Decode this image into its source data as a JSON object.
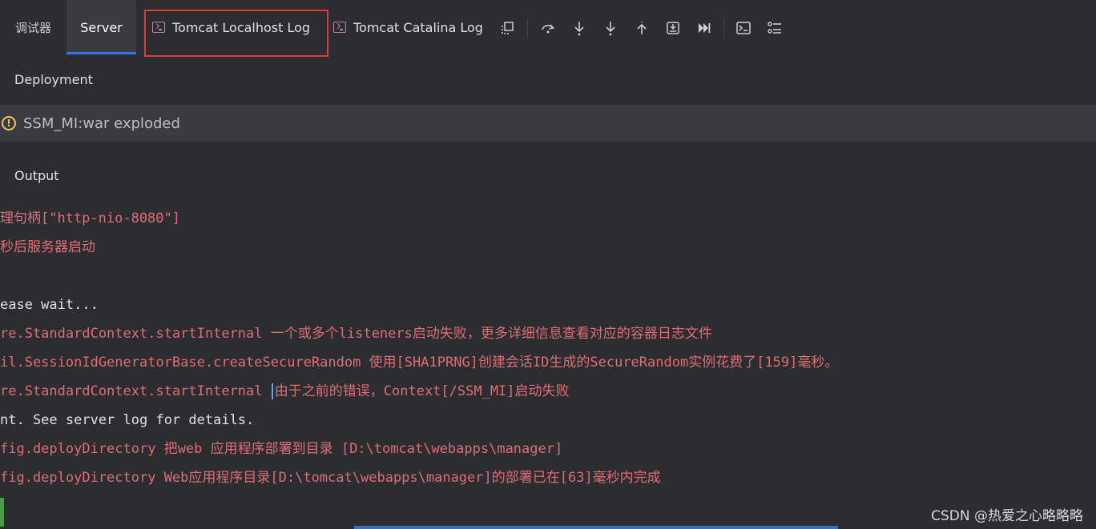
{
  "tabs": {
    "debugger": "调试器",
    "server": "Server",
    "localhost_log": "Tomcat Localhost Log",
    "catalina_log": "Tomcat Catalina Log"
  },
  "toolbar_icons": [
    "restore-layout-icon",
    "step-over-icon",
    "step-into-icon",
    "force-step-into-icon",
    "step-out-icon",
    "run-to-cursor-icon",
    "resume-icon",
    "evaluate-expression-icon",
    "more-options-icon"
  ],
  "deployment": {
    "label": "Deployment",
    "artifact": "SSM_MI:war exploded"
  },
  "output": {
    "label": "Output",
    "lines": [
      {
        "text": "理句柄[\"http-nio-8080\"]",
        "style": "red"
      },
      {
        "text": "秒后服务器启动",
        "style": "red"
      },
      {
        "text": "",
        "style": "white"
      },
      {
        "text": "ease wait...",
        "style": "white"
      },
      {
        "text": "re.StandardContext.startInternal 一个或多个listeners启动失败，更多详细信息查看对应的容器日志文件",
        "style": "red"
      },
      {
        "text": "il.SessionIdGeneratorBase.createSecureRandom 使用[SHA1PRNG]创建会话ID生成的SecureRandom实例花费了[159]毫秒。",
        "style": "red"
      },
      {
        "text_before_caret": "re.StandardContext.startInternal ",
        "text_after_caret": "由于之前的错误，Context[/SSM_MI]启动失败",
        "style": "red"
      },
      {
        "text": "nt. See server log for details.",
        "style": "white"
      },
      {
        "text": "fig.deployDirectory 把web 应用程序部署到目录 [D:\\tomcat\\webapps\\manager]",
        "style": "red"
      },
      {
        "text": "fig.deployDirectory Web应用程序目录[D:\\tomcat\\webapps\\manager]的部署已在[63]毫秒内完成",
        "style": "red"
      }
    ]
  },
  "watermark": "CSDN @热爱之心略略略",
  "colors": {
    "background": "#2b2d30",
    "accent": "#3574f0",
    "error_text": "#e06c75",
    "highlight_box": "#e03b3b",
    "warning": "#f2c55c"
  }
}
